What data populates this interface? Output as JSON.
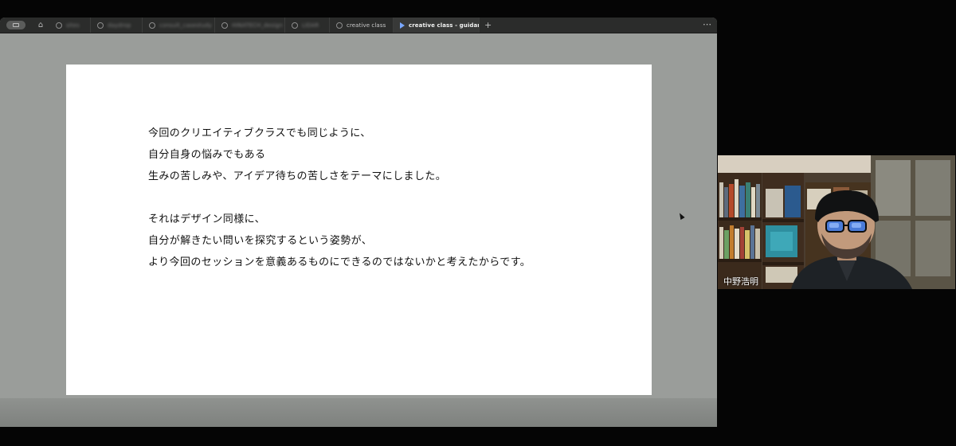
{
  "tabs": [
    {
      "label": "sites",
      "state": "blurred"
    },
    {
      "label": "daydrop",
      "state": "blurred"
    },
    {
      "label": "consult_casestudy",
      "state": "blurred"
    },
    {
      "label": "HINATECH_design",
      "state": "blurred"
    },
    {
      "label": "LIDAR",
      "state": "blurred"
    },
    {
      "label": "creative class",
      "state": "normal"
    },
    {
      "label": "creative class - guidance",
      "state": "active"
    }
  ],
  "toolbar": {
    "new_tab": "+",
    "more": "⋯",
    "home_icon": "⌂",
    "close_icon": "✕"
  },
  "slide": {
    "lines": [
      "今回のクリエイティブクラスでも同じように、",
      "自分自身の悩みでもある",
      "生みの苦しみや、アイデア待ちの苦しさをテーマにしました。",
      "",
      "それはデザイン同様に、",
      "自分が解きたい問いを探究するという姿勢が、",
      "より今回のセッションを意義あるものにできるのではないかと考えたからです。"
    ]
  },
  "participant": {
    "name": "中野浩明"
  },
  "colors": {
    "tab_bar": "#2b2c2b",
    "window_bg": "#9a9d9a",
    "active_tab_accent": "#7aa8ff"
  }
}
